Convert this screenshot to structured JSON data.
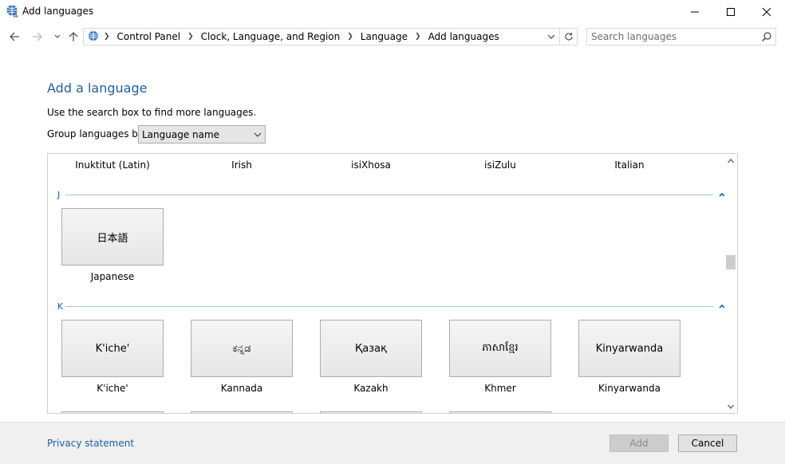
{
  "window": {
    "title": "Add languages",
    "icons": [
      "globe-language-icon",
      "minimize-icon",
      "maximize-icon",
      "close-icon"
    ]
  },
  "nav": {
    "breadcrumbs": [
      "Control Panel",
      "Clock, Language, and Region",
      "Language",
      "Add languages"
    ],
    "search_placeholder": "Search languages"
  },
  "main": {
    "heading": "Add a language",
    "hint": "Use the search box to find more languages.",
    "group_label": "Group languages by:",
    "group_value": "Language name"
  },
  "languages": {
    "top_row": [
      "Inuktitut (Latin)",
      "Irish",
      "isiXhosa",
      "isiZulu",
      "Italian"
    ],
    "groups": [
      {
        "letter": "J",
        "items": [
          {
            "native": "日本語",
            "name": "Japanese"
          }
        ]
      },
      {
        "letter": "K",
        "items": [
          {
            "native": "K'iche'",
            "name": "K'iche'"
          },
          {
            "native": "ಕನ್ನಡ",
            "name": "Kannada"
          },
          {
            "native": "Қазақ",
            "name": "Kazakh"
          },
          {
            "native": "ភាសាខ្មែរ",
            "name": "Khmer"
          },
          {
            "native": "Kinyarwanda",
            "name": "Kinyarwanda"
          }
        ]
      }
    ]
  },
  "footer": {
    "privacy": "Privacy statement",
    "add": "Add",
    "cancel": "Cancel"
  },
  "colors": {
    "link": "#1e5fa8",
    "group_line": "#a8c2dc",
    "disabled_text": "#8b8b8b"
  }
}
